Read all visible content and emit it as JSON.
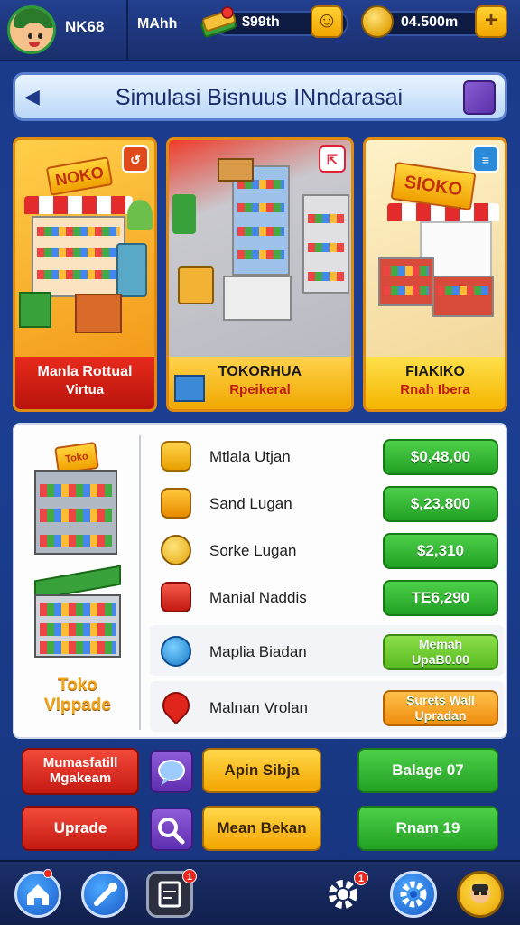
{
  "header": {
    "player_name": "NK68",
    "currency_label": "MAhh",
    "cash_amount": "$99th",
    "coin_amount": "04.500m",
    "smile_button": "☺",
    "plus_button": "+"
  },
  "title": {
    "text": "Simulasi Bisnuus INndarasai"
  },
  "shops": [
    {
      "sign": "NOKO",
      "title": "Manla Rottual",
      "subtitle": "Virtua"
    },
    {
      "sign": "",
      "title": "TOKORHUA",
      "subtitle": "Rpeikeral"
    },
    {
      "sign": "SIOKO",
      "title": "FIAKIKO",
      "subtitle": "Rnah Ibera"
    }
  ],
  "panel": {
    "sign": "Toko",
    "store_label_line1": "Toko",
    "store_label_line2": "Vlppade",
    "upgrades": [
      {
        "label": "Mtlala Utjan",
        "price": "$0,48,00",
        "icon": "scroll-icon"
      },
      {
        "label": "Sand Lugan",
        "price": "$,23.800",
        "icon": "pencil-icon"
      },
      {
        "label": "Sorke Lugan",
        "price": "$2,310",
        "icon": "coin-icon"
      },
      {
        "label": "Manial Naddis",
        "price": "TE6,290",
        "icon": "card-icon"
      },
      {
        "label": "Maplia Biadan",
        "price_line1": "Memah",
        "price_line2": "UpaB0.00",
        "icon": "refresh-icon"
      },
      {
        "label": "Malnan Vrolan",
        "price_line1": "Surets Wall",
        "price_line2": "Upradan",
        "icon": "location-pin-icon"
      }
    ]
  },
  "actions": {
    "btn1_line1": "Mumasfatill",
    "btn1_line2": "Mgakeam",
    "btn2": "Apin Sibja",
    "btn3": "Balage 07",
    "btn4": "Uprade",
    "btn5": "Mean Bekan",
    "btn6": "Rnam 19"
  },
  "nav": {
    "home_badge": "",
    "book_badge": "1",
    "gear_badge": "1"
  }
}
